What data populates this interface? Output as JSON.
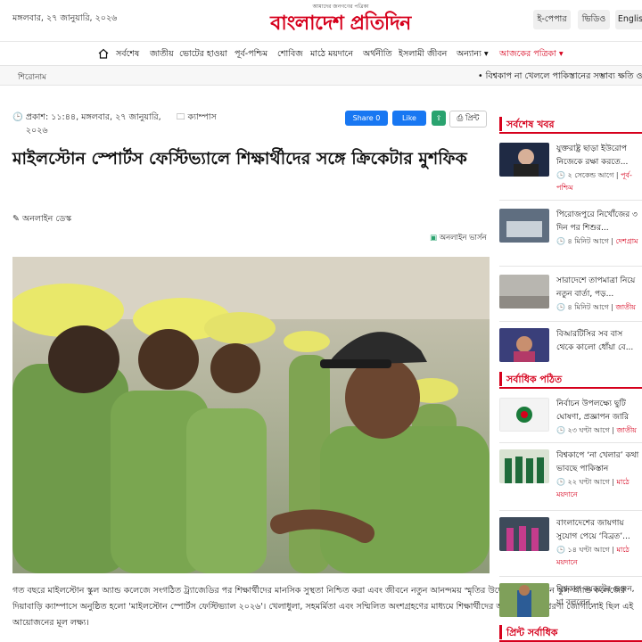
{
  "header": {
    "date": "মঙ্গলবার, ২৭ জানুয়ারি, ২০২৬",
    "logo_tagline": "আমাদের জনগণের পত্রিকা",
    "logo_name": "বাংলাদেশ প্রতিদিন",
    "buttons": [
      "ই-পেপার",
      "ভিডিও",
      "English"
    ]
  },
  "nav": {
    "items": [
      "সর্বশেষ",
      "জাতীয়",
      "ভোটের হাওয়া",
      "পূর্ব-পশ্চিম",
      "শোবিজ",
      "মাঠে ময়দানে",
      "অর্থনীতি",
      "ইসলামী জীবন",
      "অন্যান্য ▾",
      "আজকের পত্রিকা ▾"
    ]
  },
  "ticker": {
    "label": "শিরোনাম",
    "headline": "• বিশ্বকাপ না খেললে পাকিস্তানের সম্ভাব্য ক্ষতি ও প্রভাব"
  },
  "article": {
    "published": "প্রকাশ: ১১:৪৪, মঙ্গলবার, ২৭ জানুয়ারি, ২০২৬",
    "category": "ক্যাম্পাস",
    "share_facebook": "Share 0",
    "like": "Like",
    "print": "প্রিন্ট",
    "title": "মাইলস্টোন স্পোর্টস ফেস্টিভ্যালে শিক্ষার্থীদের সঙ্গে ক্রিকেটার মুশফিক",
    "author": "অনলাইন ডেস্ক",
    "online_version": "অনলাইন ভার্সন",
    "body": "গত বছরে মাইলস্টোন স্কুল অ্যান্ড কলেজে সংগঠিত ট্র্যাজেডির পর শিক্ষার্থীদের মানসিক সুস্থতা নিশ্চিত করা এবং জীবনে নতুন আনন্দময় স্মৃতির উদ্দেশ্যে মাইলস্টোন স্কুল অ্যান্ড কলেজের দিয়াবাড়ি ক্যাম্পাসে অনুষ্ঠিত হলো 'মাইলস্টোন স্পোর্টস ফেস্টিভ্যাল ২০২৬'। খেলাধুলা, সহমর্মিতা এবং সম্মিলিত অংশগ্রহণের মাধ্যমে শিক্ষার্থীদের আনন্দ ও অনুপ্রেরণা জোগানোই ছিল এই আয়োজনের মূল লক্ষ্য।"
  },
  "sidebar": {
    "latest_heading": "সর্বশেষ খবর",
    "popular_heading": "সর্বাধিক পঠিত",
    "print_heading": "প্রিন্ট সর্বাধিক",
    "latest": [
      {
        "title": "যুক্তরাষ্ট্র ছাড়া ইউরোপ নিজেকে রক্ষা করতে...",
        "time": "২ সেকেন্ড আগে",
        "cat": "পূর্ব-পশ্চিম"
      },
      {
        "title": "পিরোজপুরে নির্খোঁজের ৩ দিন পর শিশুর...",
        "time": "৪ মিনিট আগে",
        "cat": "দেশগ্রাম"
      },
      {
        "title": "সারাদেশে তাপমাত্রা নিয়ে নতুন বার্তা, পড়...",
        "time": "৪ মিনিট আগে",
        "cat": "জাতীয়"
      },
      {
        "title": "বিআরটিসির সব বাস থেকে কালো ধোঁয়া বে...",
        "time": "",
        "cat": ""
      }
    ],
    "popular": [
      {
        "title": "নির্বাচন উপলক্ষ্যে ছুটি ঘোষণা, প্রজ্ঞাপন জারি",
        "time": "২৩ ঘণ্টা আগে",
        "cat": "জাতীয়"
      },
      {
        "title": "বিশ্বকাপে ‘না খেলার’ কথা ভাবছে পাকিস্তান",
        "time": "২২ ঘণ্টা আগে",
        "cat": "মাঠে ময়দানে"
      },
      {
        "title": "বাংলাদেশের জায়গায় সুযোগ পেয়ে ‘বিব্রত’...",
        "time": "১৪ ঘণ্টা আগে",
        "cat": "মাঠে ময়দানে"
      },
      {
        "title": "বিশ্বকাপ বয়কটের গুঞ্জন, যা বললেন...",
        "time": "",
        "cat": ""
      }
    ]
  },
  "colors": {
    "brand_red": "#d6001c",
    "facebook_blue": "#1877f2"
  }
}
